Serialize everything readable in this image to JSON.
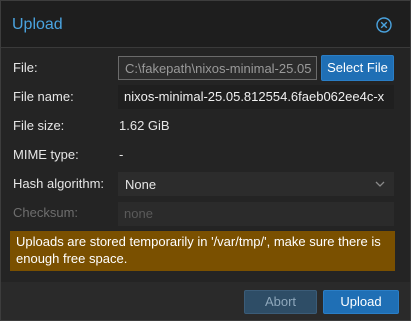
{
  "dialog": {
    "title": "Upload",
    "accent_color": "#4aa3df"
  },
  "form": {
    "file": {
      "label": "File:",
      "value": "C:\\fakepath\\nixos-minimal-25.05",
      "button_label": "Select File"
    },
    "file_name": {
      "label": "File name:",
      "value": "nixos-minimal-25.05.812554.6faeb062ee4c-x"
    },
    "file_size": {
      "label": "File size:",
      "value": "1.62 GiB"
    },
    "mime_type": {
      "label": "MIME type:",
      "value": "-"
    },
    "hash_algorithm": {
      "label": "Hash algorithm:",
      "selected": "None"
    },
    "checksum": {
      "label": "Checksum:",
      "placeholder": "none"
    }
  },
  "warning": {
    "text": "Uploads are stored temporarily in '/var/tmp/', make sure there is enough free space.",
    "color": "#7a5000"
  },
  "footer": {
    "abort_label": "Abort",
    "upload_label": "Upload"
  },
  "icons": {
    "close": "close-circle-icon",
    "dropdown": "chevron-down-icon"
  }
}
